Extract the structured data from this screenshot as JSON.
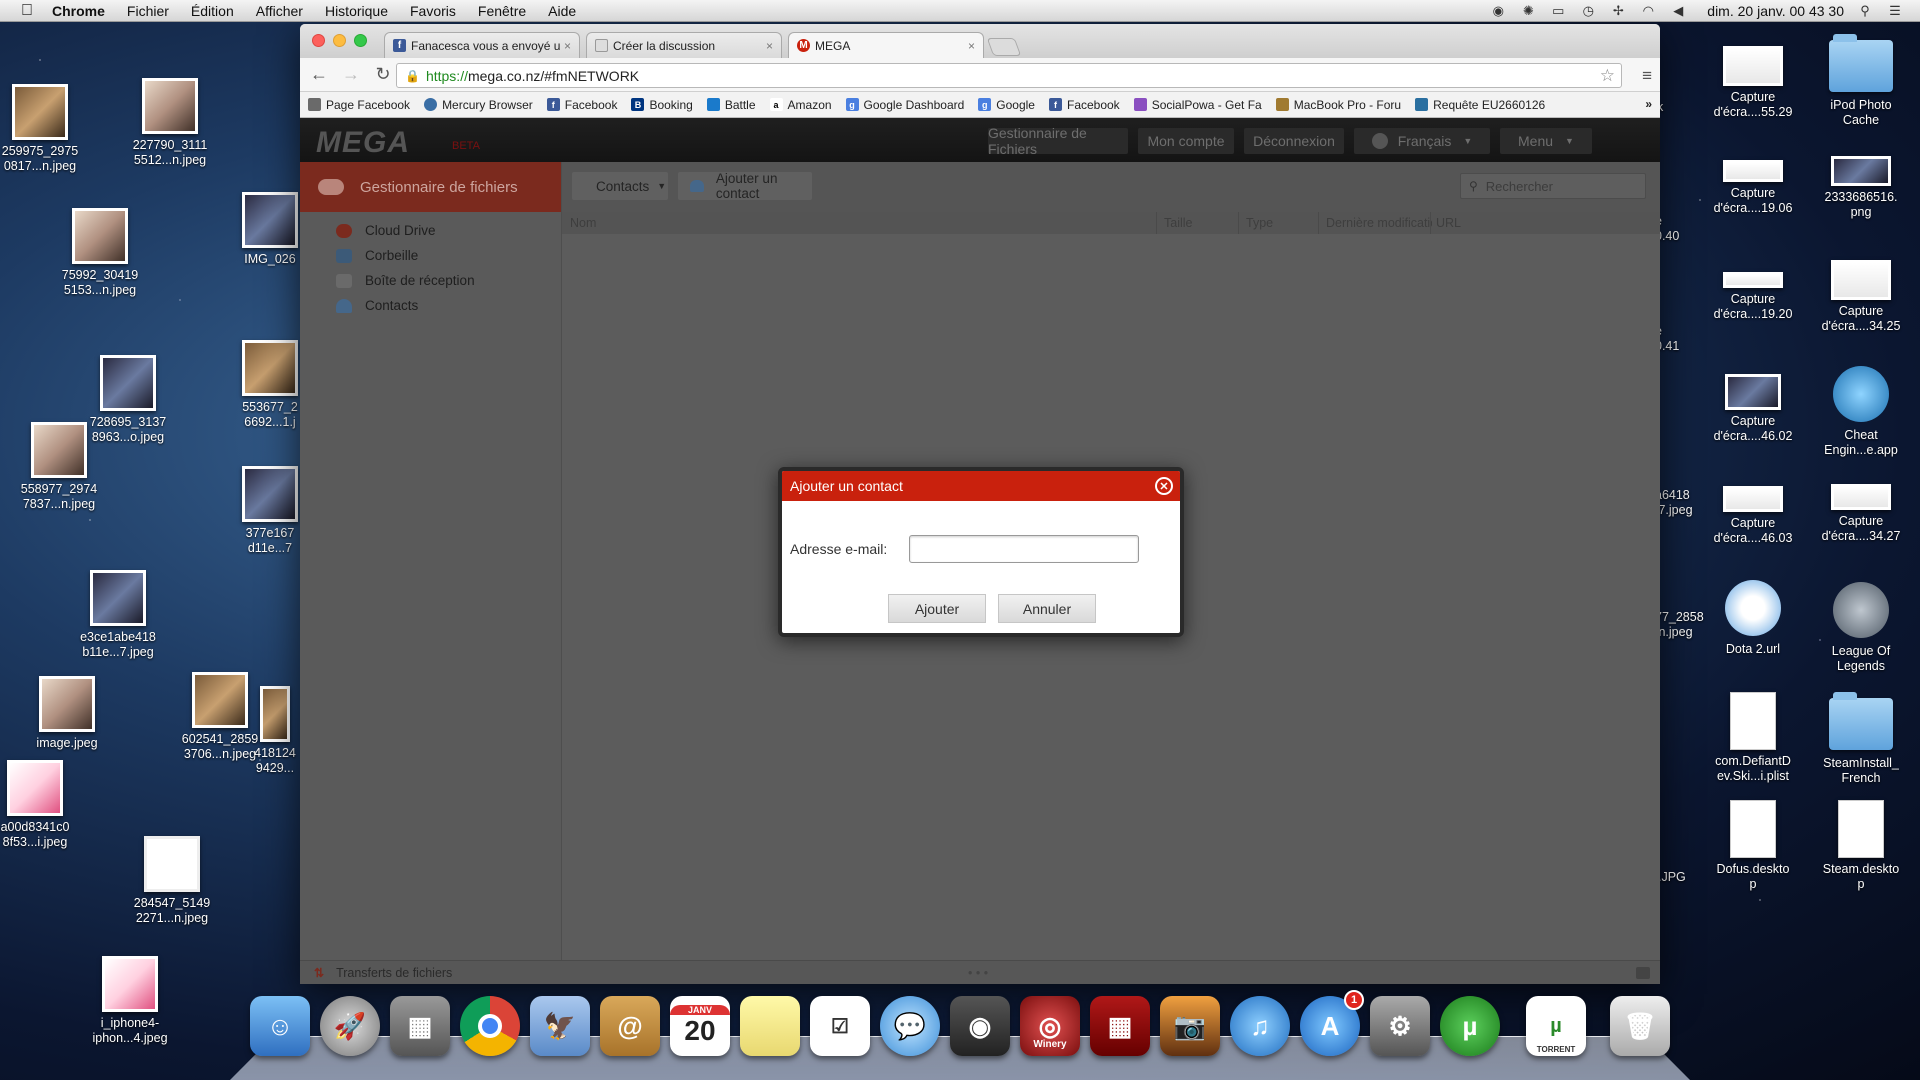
{
  "menubar": {
    "app": "Chrome",
    "items": [
      "Fichier",
      "Édition",
      "Afficher",
      "Historique",
      "Favoris",
      "Fenêtre",
      "Aide"
    ],
    "clock": "dim. 20 janv.  00 43 30"
  },
  "desktop_left": [
    {
      "label": "259975_2975\n0817...n.jpeg"
    },
    {
      "label": "227790_3111\n5512...n.jpeg"
    },
    {
      "label": "75992_30419\n5153...n.jpeg"
    },
    {
      "label": "IMG_026"
    },
    {
      "label": "728695_3137\n8963...o.jpeg"
    },
    {
      "label": "553677_2\n6692...1.j"
    },
    {
      "label": "558977_2974\n7837...n.jpeg"
    },
    {
      "label": "377e167\nd11e...7"
    },
    {
      "label": "e3ce1abe418\nb11e...7.jpeg"
    },
    {
      "label": "image.jpeg"
    },
    {
      "label": "602541_2859\n3706...n.jpeg"
    },
    {
      "label": "418124\n9429..."
    },
    {
      "label": "a00d8341c0\n8f53...i.jpeg"
    },
    {
      "label": "284547_5149\n2271...n.jpeg"
    },
    {
      "label": "i_iphone4-\niphon...4.jpeg"
    }
  ],
  "desktop_right": [
    {
      "label": "Capture\nd'écra....55.29"
    },
    {
      "label": "iPod Photo\nCache"
    },
    {
      "label": "Capture\nd'écra....19.06"
    },
    {
      "label": "2333686516.\npng"
    },
    {
      "label": "Capture\nd'écra....19.20"
    },
    {
      "label": "Capture\nd'écra....34.25"
    },
    {
      "label": "Capture\nd'écra....46.02"
    },
    {
      "label": "Cheat\nEngin...e.app"
    },
    {
      "label": "Capture\nd'écra....46.03"
    },
    {
      "label": "Capture\nd'écra....34.27"
    },
    {
      "label": "Dota 2.url"
    },
    {
      "label": "League Of\nLegends"
    },
    {
      "label": "com.DefiantD\nev.Ski...i.plist"
    },
    {
      "label": "SteamInstall_\nFrench"
    },
    {
      "label": "Dofus.deskto\np"
    },
    {
      "label": "Steam.deskto\np"
    }
  ],
  "desktop_partial": [
    {
      "label": "nk"
    },
    {
      "label": "e\n0.40"
    },
    {
      "label": "e\n0.41"
    },
    {
      "label": "a6418\n.7.jpeg"
    },
    {
      "label": "77_2858\n.n.jpeg"
    },
    {
      "label": ".JPG"
    }
  ],
  "browser": {
    "tabs": [
      {
        "title": "Fanacesca vous a envoyé un",
        "close": "×"
      },
      {
        "title": "Créer la discussion",
        "close": "×"
      },
      {
        "title": "MEGA",
        "close": "×"
      }
    ],
    "url_scheme": "https://",
    "url_rest": "mega.co.nz/#fmNETWORK",
    "bookmarks": [
      "Page Facebook",
      "Mercury Browser",
      "Facebook",
      "Booking",
      "Battle",
      "Amazon",
      "Google Dashboard",
      "Google",
      "Facebook",
      "SocialPowa - Get Fa",
      "MacBook Pro - Foru",
      "Requête EU2660126"
    ]
  },
  "mega": {
    "logo": "MEGA",
    "beta": "BETA",
    "nav": [
      "Gestionnaire de Fichiers",
      "Mon compte",
      "Déconnexion",
      "Français",
      "Menu"
    ],
    "sidebar_title": "Gestionnaire de fichiers",
    "sidebar_items": [
      "Cloud Drive",
      "Corbeille",
      "Boîte de réception",
      "Contacts"
    ],
    "toolbar": {
      "contacts": "Contacts",
      "add_contact": "Ajouter un contact",
      "search_placeholder": "Rechercher"
    },
    "columns": [
      "Nom",
      "Taille",
      "Type",
      "Dernière modificatio",
      "URL"
    ],
    "transfers": "Transferts de fichiers"
  },
  "dialog": {
    "title": "Ajouter un contact",
    "email_label": "Adresse e-mail:",
    "email_value": "",
    "add_button": "Ajouter",
    "cancel_button": "Annuler"
  },
  "dock": {
    "calendar_day": "20",
    "calendar_month": "JANV",
    "winery_label": "Winery",
    "appstore_badge": "1",
    "torrent_label": "TORRENT"
  },
  "colors": {
    "mega_red": "#c9210d",
    "desktop_bg": "#1d3a62"
  }
}
